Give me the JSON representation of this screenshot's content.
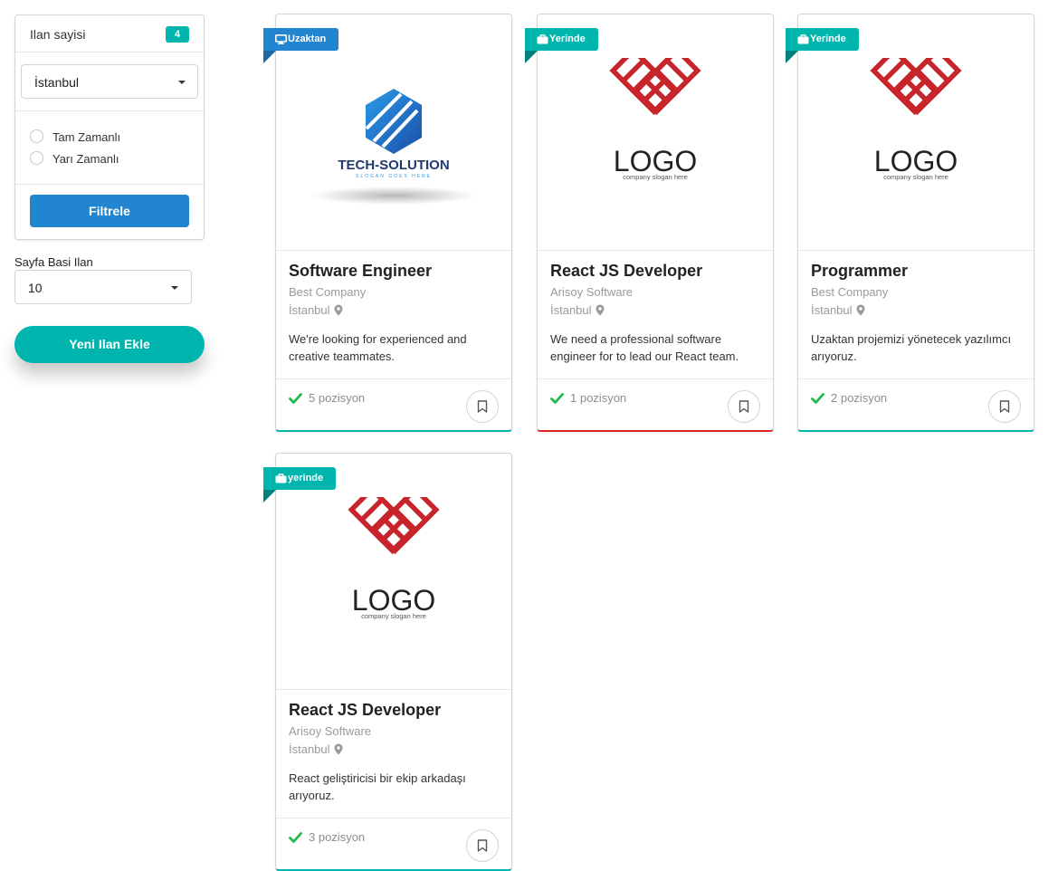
{
  "sidebar": {
    "count_label": "Ilan sayisi",
    "count_value": "4",
    "city_select": "İstanbul",
    "radios": [
      {
        "label": "Tam Zamanlı"
      },
      {
        "label": "Yarı Zamanlı"
      }
    ],
    "filter_button": "Filtrele",
    "per_page_label": "Sayfa Basi Ilan",
    "per_page_value": "10",
    "new_button": "Yeni Ilan Ekle"
  },
  "colors": {
    "teal": "#00b5ad",
    "blue": "#2185d0",
    "red": "#db2828",
    "check_green": "#21ba45"
  },
  "jobs": [
    {
      "ribbon": "Uzaktan",
      "ribbon_icon": "desktop-icon",
      "logo": "tech-solution-logo",
      "logo_text": "TECH-SOLUTION",
      "logo_tagline": "SLOGAN GOES HERE",
      "title": "Software Engineer",
      "company": "Best Company",
      "city": "İstanbul",
      "description": "We're looking for experienced and creative teammates.",
      "positions": "5 pozisyon"
    },
    {
      "ribbon": "Yerinde",
      "ribbon_icon": "briefcase-icon",
      "logo": "generic-logo",
      "logo_text": "LOGO",
      "logo_tagline": "company slogan here",
      "title": "React JS Developer",
      "company": "Arisoy Software",
      "city": "İstanbul",
      "description": "We need a professional software engineer for to lead our React team.",
      "positions": "1 pozisyon"
    },
    {
      "ribbon": "Yerinde",
      "ribbon_icon": "briefcase-icon",
      "logo": "generic-logo",
      "logo_text": "LOGO",
      "logo_tagline": "company slogan here",
      "title": "Programmer",
      "company": "Best Company",
      "city": "İstanbul",
      "description": "Uzaktan projemizi yönetecek yazılımcı arıyoruz.",
      "positions": "2 pozisyon"
    },
    {
      "ribbon": "yerinde",
      "ribbon_icon": "briefcase-icon",
      "logo": "generic-logo",
      "logo_text": "LOGO",
      "logo_tagline": "company slogan here",
      "title": "React JS Developer",
      "company": "Arisoy Software",
      "city": "İstanbul",
      "description": "React geliştiricisi bir ekip arkadaşı arıyoruz.",
      "positions": "3 pozisyon"
    }
  ]
}
